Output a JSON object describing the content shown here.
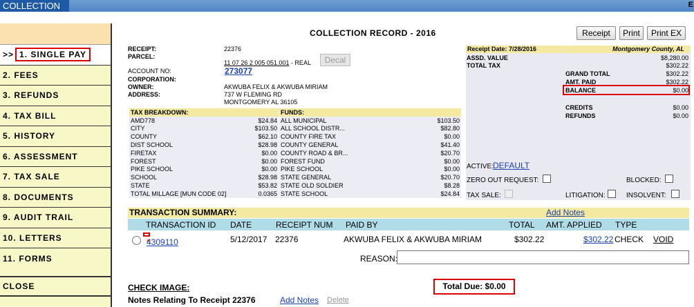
{
  "topbar": {
    "tab": "COLLECTION",
    "edge_text": "E"
  },
  "menu": [
    {
      "label": "1. SINGLE PAY",
      "active": true
    },
    {
      "label": "2. FEES"
    },
    {
      "label": "3. REFUNDS"
    },
    {
      "label": "4. TAX BILL"
    },
    {
      "label": "5. HISTORY"
    },
    {
      "label": "6. ASSESSMENT"
    },
    {
      "label": "7. TAX SALE"
    },
    {
      "label": "8. DOCUMENTS"
    },
    {
      "label": "9. AUDIT TRAIL"
    },
    {
      "label": "10. LETTERS"
    },
    {
      "label": "11. FORMS"
    },
    {
      "label": "CLOSE"
    }
  ],
  "menu_arrow": ">>",
  "record": {
    "title": "COLLECTION RECORD - 2016",
    "buttons": [
      "Receipt",
      "Print",
      "Print EX"
    ],
    "receipt_label": "RECEIPT:",
    "receipt": "22376",
    "parcel_label": "PARCEL:",
    "parcel": "11 07 26 2 005 051.001",
    "parcel_suffix": "- REAL",
    "decal": "Decal",
    "account_label": "ACCOUNT NO:",
    "account": "273077",
    "corporation_label": "CORPORATION:",
    "owner_label": "OWNER:",
    "owner": "AKWUBA FELIX & AKWUBA MIRIAM",
    "address_label": "ADDRESS:",
    "address1": "737 W FLEMING RD",
    "address2": "MONTGOMERY AL   36105"
  },
  "tax_breakdown": {
    "header": "TAX BREAKDOWN:",
    "rows": [
      [
        "AMD778",
        "$24.84"
      ],
      [
        "CITY",
        "$103.50"
      ],
      [
        "COUNTY",
        "$62.10"
      ],
      [
        "DIST SCHOOL",
        "$28.98"
      ],
      [
        "FIRETAX",
        "$0.00"
      ],
      [
        "FOREST",
        "$0.00"
      ],
      [
        "PIKE SCHOOL",
        "$0.00"
      ],
      [
        "SCHOOL",
        "$28.98"
      ],
      [
        "STATE",
        "$53.82"
      ],
      [
        "TOTAL MILLAGE [MUN CODE 02]",
        "0.0365"
      ]
    ]
  },
  "funds": {
    "header": "FUNDS:",
    "rows": [
      [
        "ALL MUNICIPAL",
        "$103.50"
      ],
      [
        "ALL SCHOOL DISTR...",
        "$82.80"
      ],
      [
        "COUNTY FIRE TAX",
        "$0.00"
      ],
      [
        "COUNTY GENERAL",
        "$41.40"
      ],
      [
        "COUNTY ROAD & BR...",
        "$20.70"
      ],
      [
        "FOREST FUND",
        "$0.00"
      ],
      [
        "PIKE SCHOOL",
        "$0.00"
      ],
      [
        "STATE GENERAL",
        "$20.70"
      ],
      [
        "STATE OLD SOLDIER",
        "$8.28"
      ],
      [
        "STATE SCHOOL",
        "$24.84"
      ]
    ]
  },
  "right": {
    "receipt_date": "Receipt Date: 7/28/2016",
    "county": "Montgomery County, AL",
    "assd_label": "ASSD. VALUE",
    "assd": "$8,280.00",
    "total_tax_label": "TOTAL TAX",
    "total_tax": "$302.22",
    "grand_total_label": "GRAND TOTAL",
    "grand_total": "$302.22",
    "amt_paid_label": "AMT. PAID",
    "amt_paid": "$302.22",
    "balance_label": "BALANCE",
    "balance": "$0.00",
    "credits_label": "CREDITS",
    "credits": "$0.00",
    "refunds_label": "REFUNDS",
    "refunds": "$0.00",
    "active_label": "ACTIVE:",
    "active_value": "DEFAULT",
    "zero_out_label": "ZERO OUT REQUEST:",
    "blocked_label": "BLOCKED:",
    "tax_sale_label": "TAX SALE:",
    "litigation_label": "LITIGATION:",
    "insolvent_label": "INSOLVENT:"
  },
  "transactions": {
    "header": "TRANSACTION SUMMARY:",
    "add_notes": "Add Notes",
    "columns": [
      "TRANSACTION ID",
      "DATE",
      "RECEIPT NUM",
      "PAID BY",
      "TOTAL",
      "AMT. APPLIED",
      "TYPE"
    ],
    "row": {
      "id": "4309110",
      "marker": "*",
      "date": "5/12/2017",
      "receipt_num": "22376",
      "paid_by": "AKWUBA FELIX & AKWUBA MIRIAM",
      "total": "$302.22",
      "applied": "$302.22",
      "type": "CHECK",
      "action": "VOID"
    },
    "reason_label": "REASON:"
  },
  "footer": {
    "check_image": "CHECK IMAGE:",
    "total_due": "Total Due: $0.00",
    "notes_label": "Notes Relating To Receipt 22376",
    "add_notes": "Add Notes",
    "delete": "Delete"
  },
  "colors": {
    "accent_blue": "#1f5aa6",
    "highlight_red": "#dd0000",
    "header_yellow": "#f3e9a0",
    "column_blue": "#b0dce8"
  }
}
